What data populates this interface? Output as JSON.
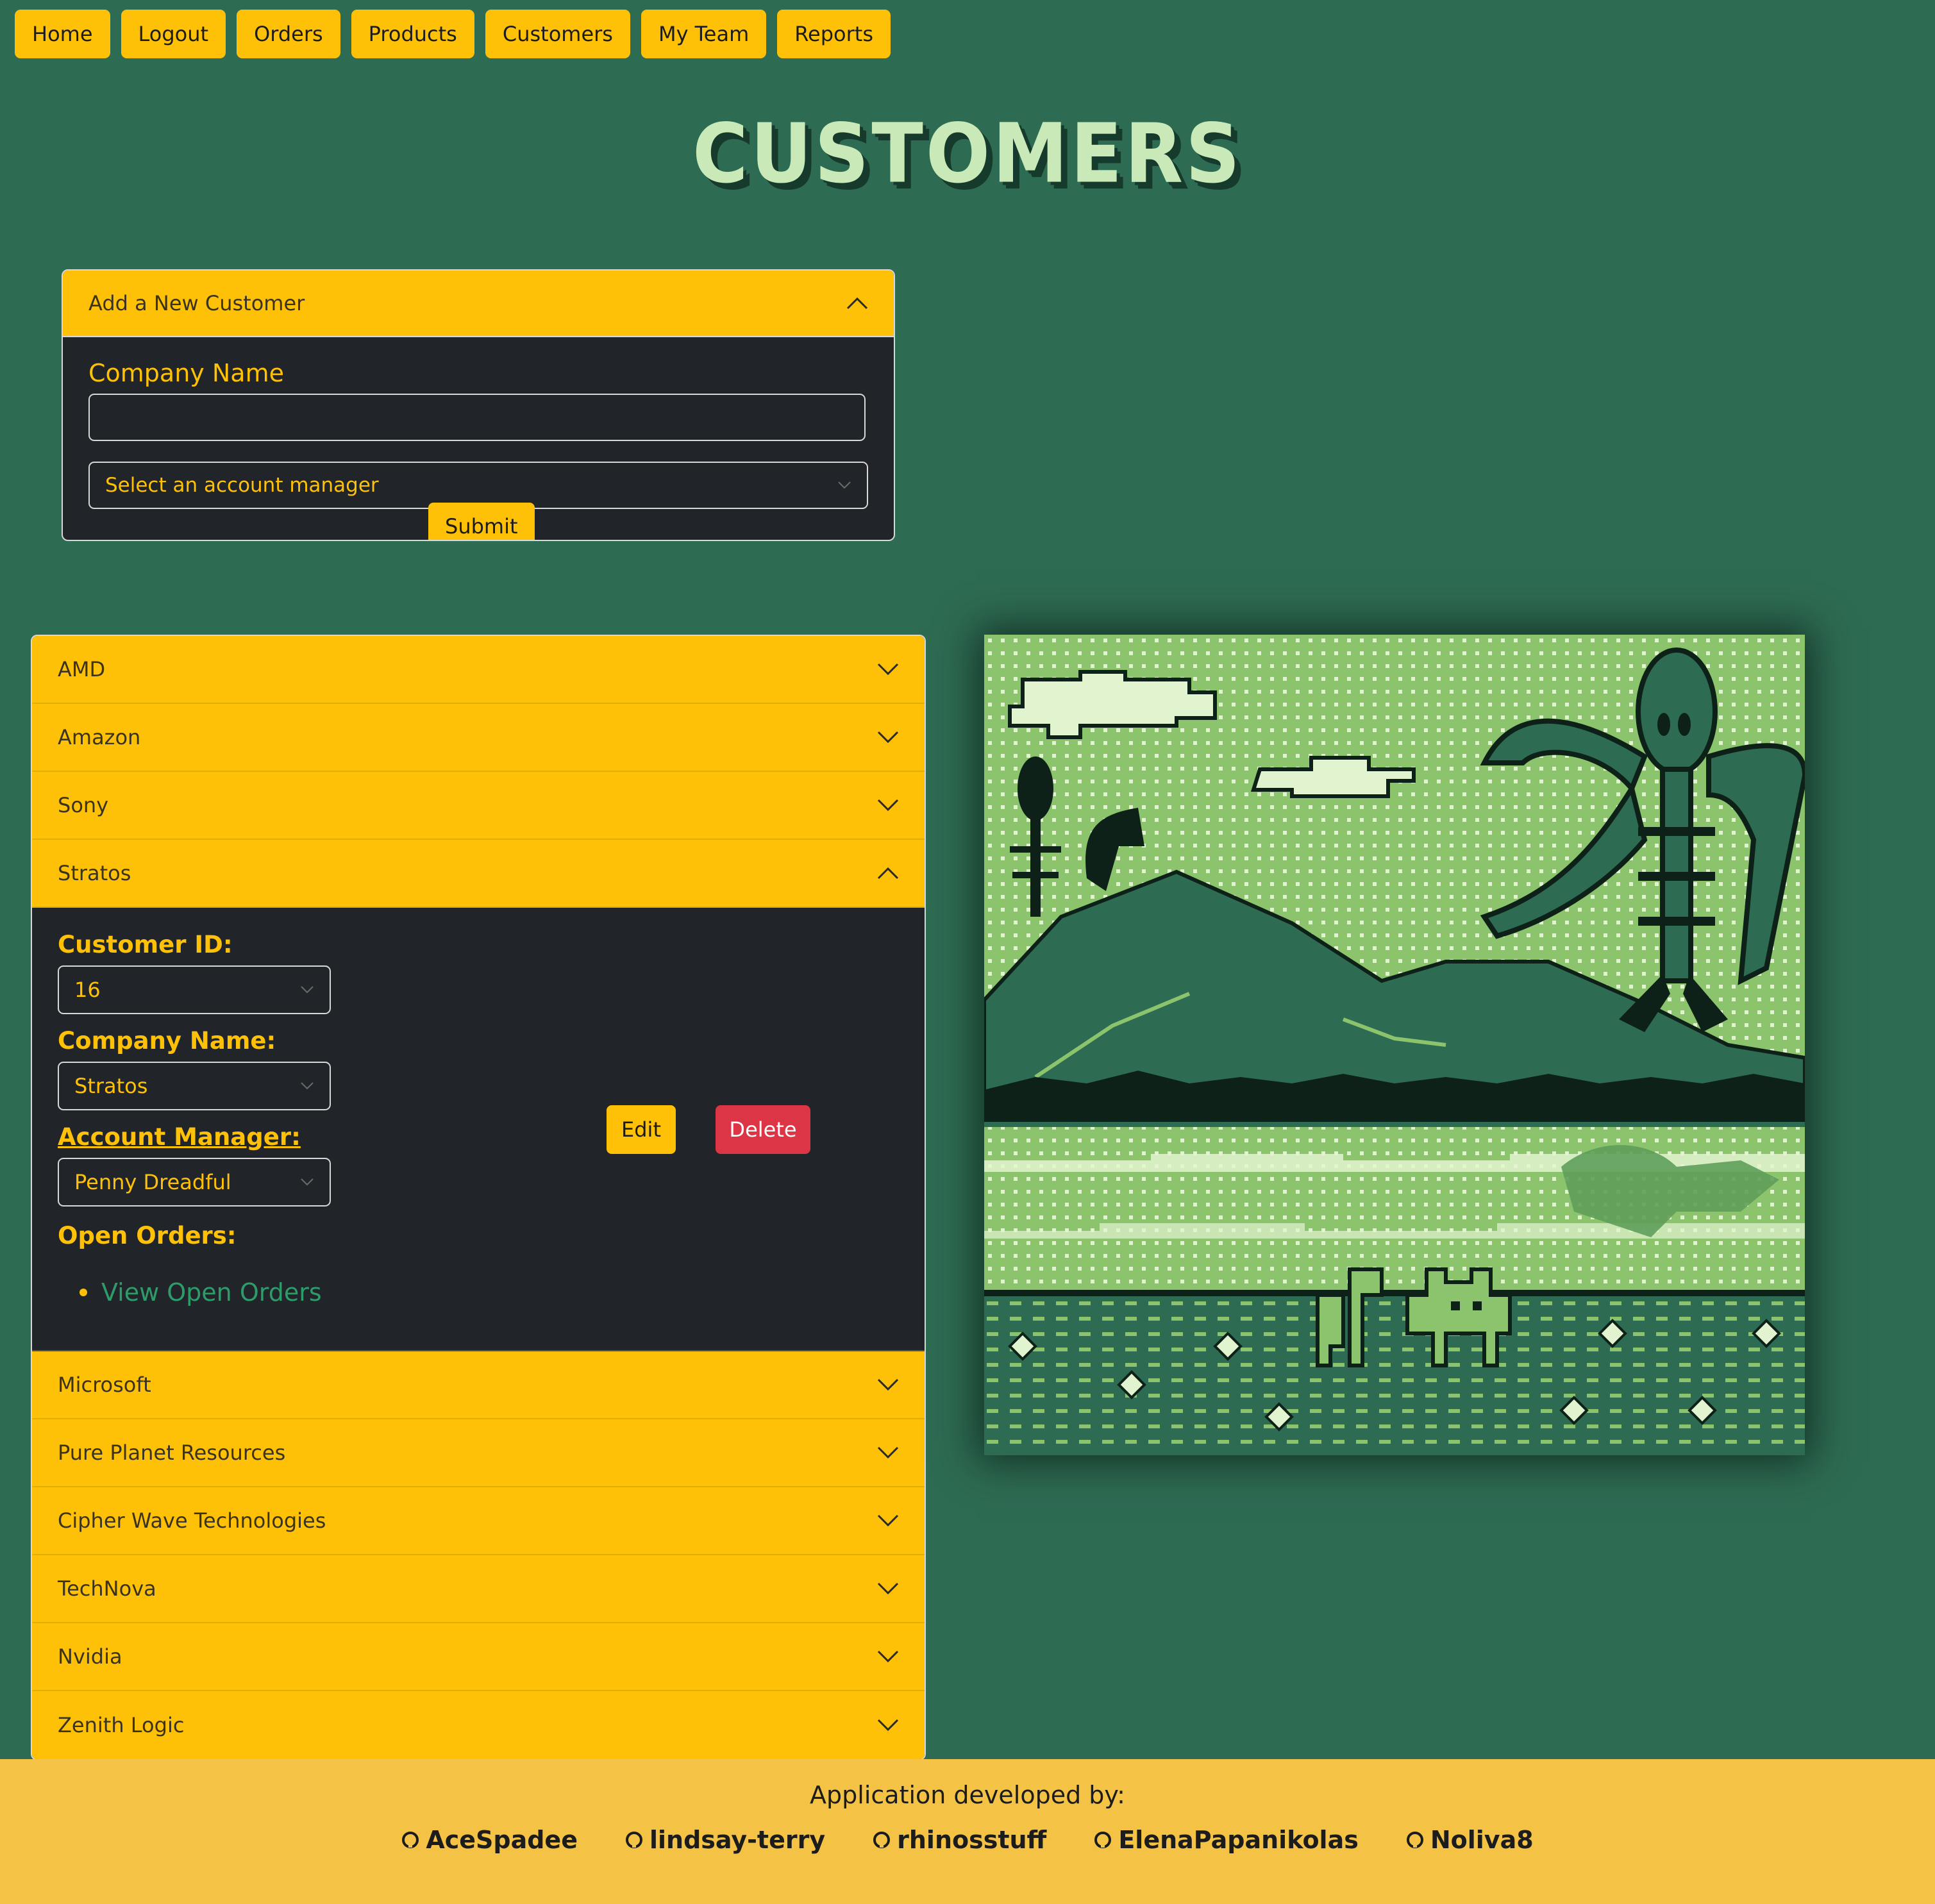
{
  "nav": [
    "Home",
    "Logout",
    "Orders",
    "Products",
    "Customers",
    "My Team",
    "Reports"
  ],
  "page_title": "CUSTOMERS",
  "new_customer": {
    "header": "Add a New Customer",
    "company_label": "Company Name",
    "company_value": "",
    "manager_placeholder": "Select an account manager",
    "submit": "Submit"
  },
  "customers": [
    {
      "name": "AMD",
      "expanded": false
    },
    {
      "name": "Amazon",
      "expanded": false
    },
    {
      "name": "Sony",
      "expanded": false
    },
    {
      "name": "Stratos",
      "expanded": true
    },
    {
      "name": "Microsoft",
      "expanded": false
    },
    {
      "name": "Pure Planet Resources",
      "expanded": false
    },
    {
      "name": "Cipher Wave Technologies",
      "expanded": false
    },
    {
      "name": "TechNova",
      "expanded": false
    },
    {
      "name": "Nvidia",
      "expanded": false
    },
    {
      "name": "Zenith Logic",
      "expanded": false
    }
  ],
  "detail": {
    "customer_id_label": "Customer ID:",
    "customer_id": "16",
    "company_label": "Company Name:",
    "company": "Stratos",
    "manager_label": "Account Manager:",
    "manager": "Penny Dreadful",
    "orders_label": "Open Orders:",
    "orders_link": "View Open Orders",
    "edit": "Edit",
    "delete": "Delete"
  },
  "footer": {
    "title": "Application developed by:",
    "credits": [
      "AceSpadee",
      "lindsay-terry",
      "rhinosstuff",
      "ElenaPapanikolas",
      "Noliva8"
    ]
  },
  "colors": {
    "background": "#2e6b53",
    "accent": "#ffc107",
    "panel": "#212529",
    "danger": "#dc3545",
    "footer": "#f4c244"
  },
  "icons": {
    "accordion_closed": "chevron-down-icon",
    "accordion_open": "chevron-up-icon",
    "select": "chevron-down-icon",
    "credit": "github-icon"
  }
}
